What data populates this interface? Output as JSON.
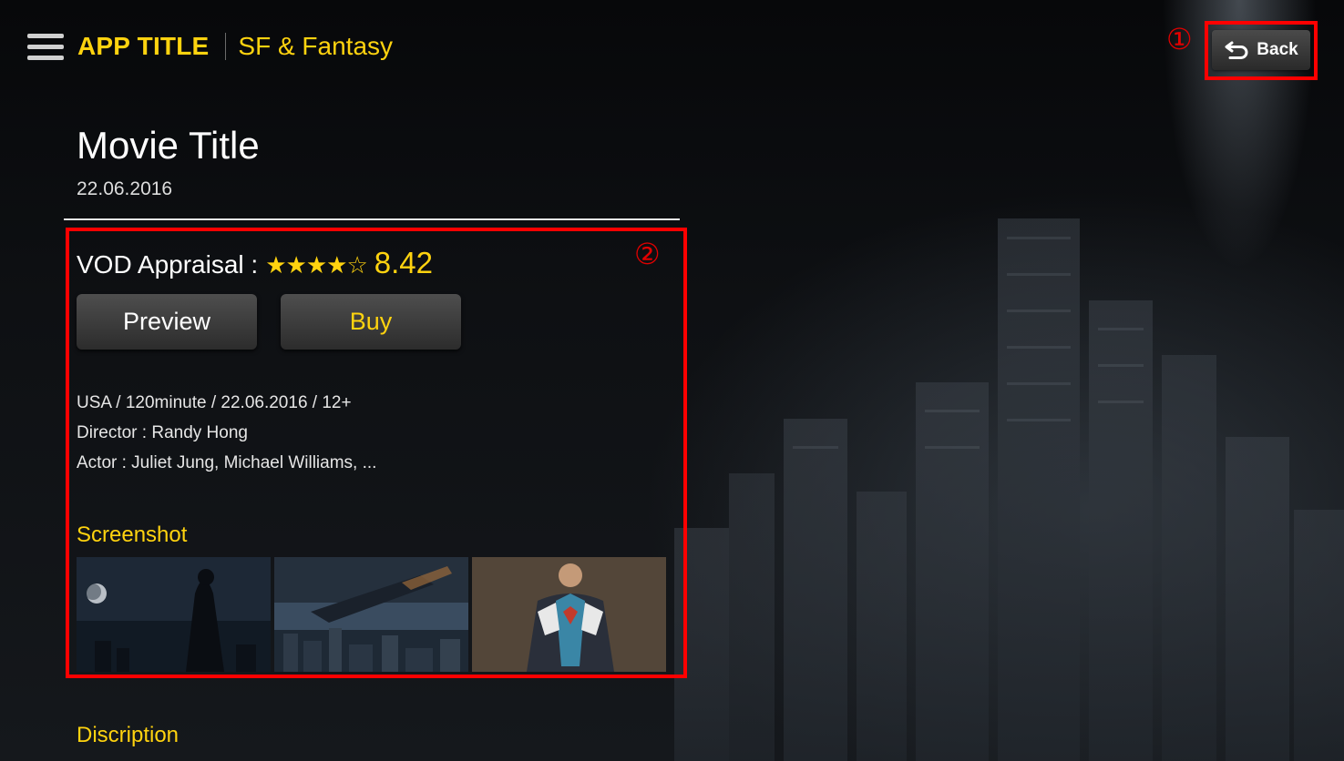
{
  "header": {
    "app_title": "APP TITLE",
    "category": "SF & Fantasy",
    "menu_icon": "hamburger-menu-icon"
  },
  "back_button": {
    "label": "Back",
    "icon": "return-arrow-icon"
  },
  "annotations": {
    "marker_1": "①",
    "marker_2": "②",
    "color": "#ff0000"
  },
  "movie": {
    "title": "Movie Title",
    "date": "22.06.2016"
  },
  "appraisal": {
    "label": "VOD Appraisal :",
    "stars": "★★★★☆",
    "rating_stars": 4,
    "rating_max": 5,
    "score": "8.42"
  },
  "actions": {
    "preview_label": "Preview",
    "buy_label": "Buy"
  },
  "details": {
    "line1": "USA / 120minute / 22.06.2016 / 12+",
    "line2": "Director : Randy Hong",
    "line3": "Actor : Juliet Jung, Michael Williams, ..."
  },
  "screenshots": {
    "heading": "Screenshot",
    "count": 3
  },
  "description": {
    "heading": "Discription"
  },
  "colors": {
    "accent": "#ffd30f",
    "background": "#0d0f12",
    "text": "#ffffff"
  }
}
